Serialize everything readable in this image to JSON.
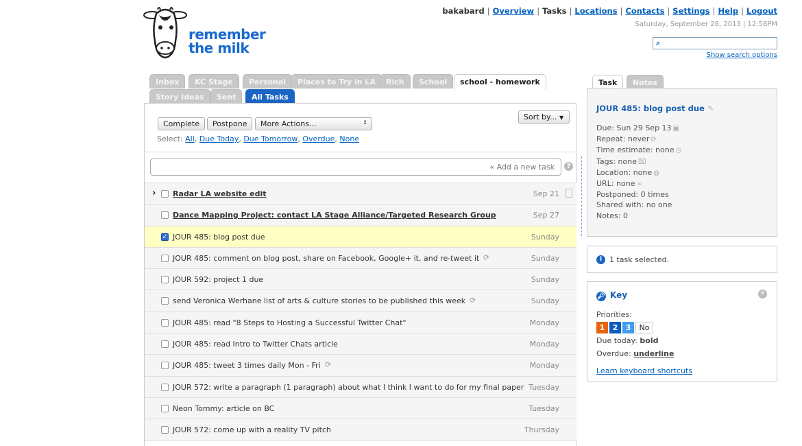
{
  "logo": {
    "line1": "remember",
    "line2": "the milk"
  },
  "header": {
    "user": "bakabard",
    "nav": [
      {
        "label": "Overview",
        "link": true
      },
      {
        "label": "Tasks",
        "link": false
      },
      {
        "label": "Locations",
        "link": true
      },
      {
        "label": "Contacts",
        "link": true
      },
      {
        "label": "Settings",
        "link": true
      },
      {
        "label": "Help",
        "link": true
      },
      {
        "label": "Logout",
        "link": true
      }
    ],
    "datetime": "Saturday, September 28, 2013 | 12:58PM",
    "search_placeholder": "",
    "search_options": "Show search options"
  },
  "list_tabs": [
    "Inbox",
    "KC Stage",
    "Personal",
    "Places to Try in LA",
    "Rich",
    "School",
    "school - homework",
    "Story Ideas",
    "Sent",
    "All Tasks"
  ],
  "toolbar": {
    "complete": "Complete",
    "postpone": "Postpone",
    "more_actions": "More Actions...",
    "sort_by": "Sort by...",
    "select_label": "Select:",
    "select_links": [
      "All",
      "Due Today",
      "Due Tomorrow",
      "Overdue",
      "None"
    ],
    "add_task": "« Add a new task"
  },
  "tasks": [
    {
      "name": "Radar LA website edit",
      "due": "Sep 21",
      "overdue": true,
      "checked": false
    },
    {
      "name": "Dance Mapping Project: contact LA Stage Alliance/Targeted Research Group",
      "due": "Sep 27",
      "overdue": true,
      "checked": false
    },
    {
      "name": "JOUR 485: blog post due",
      "due": "Sunday",
      "checked": true
    },
    {
      "name": "JOUR 485: comment on blog post, share on Facebook, Google+ it, and re-tweet it",
      "due": "Sunday",
      "repeat": true
    },
    {
      "name": "JOUR 592: project 1 due",
      "due": "Sunday"
    },
    {
      "name": "send Veronica Werhane list of arts & culture stories to be published this week",
      "due": "Sunday",
      "repeat": true
    },
    {
      "name": "JOUR 485: read \"8 Steps to Hosting a Successful Twitter Chat\"",
      "due": "Monday"
    },
    {
      "name": "JOUR 485: read Intro to Twitter Chats article",
      "due": "Monday"
    },
    {
      "name": "JOUR 485: tweet 3 times daily Mon - Fri",
      "due": "Monday",
      "repeat": true
    },
    {
      "name": "JOUR 572: write a paragraph (1 paragraph) about what I think I want to do for my final paper",
      "due": "Tuesday"
    },
    {
      "name": "Neon Tommy: article on BC",
      "due": "Tuesday"
    },
    {
      "name": "JOUR 572: come up with a reality TV pitch",
      "due": "Thursday"
    }
  ],
  "detail": {
    "tabs": [
      "Task",
      "Notes"
    ],
    "title": "JOUR 485: blog post due",
    "lines": [
      "Due: Sun 29 Sep 13",
      "Repeat: never",
      "Time estimate: none",
      "Tags: none",
      "Location: none",
      "URL: none",
      "Postponed: 0 times",
      "Shared with: no one",
      "Notes: 0"
    ]
  },
  "status": {
    "text": "1 task selected."
  },
  "key": {
    "title": "Key",
    "priorities_label": "Priorities:",
    "priorities": [
      "1",
      "2",
      "3",
      "No"
    ],
    "due_today_label": "Due today:",
    "due_today_value": "bold",
    "overdue_label": "Overdue:",
    "overdue_value": "underline",
    "shortcuts": "Learn keyboard shortcuts"
  },
  "colors": {
    "p1": "#e8630a",
    "p2": "#0b5cbf",
    "p3": "#3f9cf0",
    "accent": "#1a64c4",
    "highlight": "#ffffc4"
  }
}
